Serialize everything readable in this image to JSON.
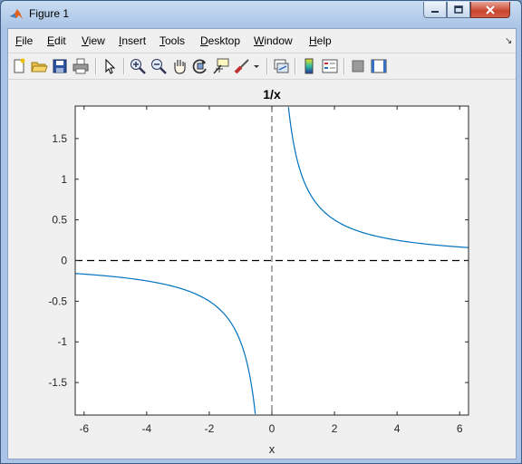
{
  "window": {
    "title": "Figure 1"
  },
  "menu": [
    "File",
    "Edit",
    "View",
    "Insert",
    "Tools",
    "Desktop",
    "Window",
    "Help"
  ],
  "toolbar": {
    "icons": [
      "new-figure-icon",
      "open-file-icon",
      "save-icon",
      "print-icon",
      "edit-plot-arrow-icon",
      "zoom-in-icon",
      "zoom-out-icon",
      "pan-hand-icon",
      "rotate-3d-icon",
      "data-cursor-icon",
      "brush-icon",
      "brush-dropdown-icon",
      "link-plot-icon",
      "colorbar-icon",
      "legend-icon",
      "hide-plot-tools-icon",
      "show-plot-tools-icon"
    ]
  },
  "colors": {
    "line": "#0072bd",
    "axes": "#262626",
    "figure_bg": "#f0f0f0"
  },
  "chart_data": {
    "type": "line",
    "title": "1/x",
    "xlabel": "x",
    "ylabel": "",
    "xlim": [
      -6.283,
      6.283
    ],
    "ylim": [
      -1.9,
      1.9
    ],
    "xticks": [
      -6,
      -4,
      -2,
      0,
      2,
      4,
      6
    ],
    "xtick_labels": [
      "-6",
      "-4",
      "-2",
      "0",
      "2",
      "4",
      "6"
    ],
    "yticks": [
      -1.5,
      -1,
      -0.5,
      0,
      0.5,
      1,
      1.5
    ],
    "ytick_labels": [
      "-1.5",
      "-1",
      "-0.5",
      "0",
      "0.5",
      "1",
      "1.5"
    ],
    "grid": false,
    "series": [
      {
        "x": [
          -6.283,
          -5,
          -4,
          -3,
          -2.5,
          -2,
          -1.5,
          -1.2,
          -1,
          -0.8,
          -0.7,
          -0.6,
          -0.53
        ],
        "y": [
          -0.159,
          -0.2,
          -0.25,
          -0.333,
          -0.4,
          -0.5,
          -0.667,
          -0.833,
          -1,
          -1.25,
          -1.429,
          -1.667,
          -1.887
        ]
      },
      {
        "x": [
          0.53,
          0.6,
          0.7,
          0.8,
          1,
          1.2,
          1.5,
          2,
          2.5,
          3,
          4,
          5,
          6.283
        ],
        "y": [
          1.887,
          1.667,
          1.429,
          1.25,
          1,
          0.833,
          0.667,
          0.5,
          0.4,
          0.333,
          0.25,
          0.2,
          0.159
        ]
      }
    ],
    "reference_lines": [
      {
        "orientation": "horizontal",
        "value": 0,
        "style": "dashed",
        "color": "#000000"
      },
      {
        "orientation": "vertical",
        "value": 0,
        "style": "dashed",
        "color": "#555555"
      }
    ]
  }
}
